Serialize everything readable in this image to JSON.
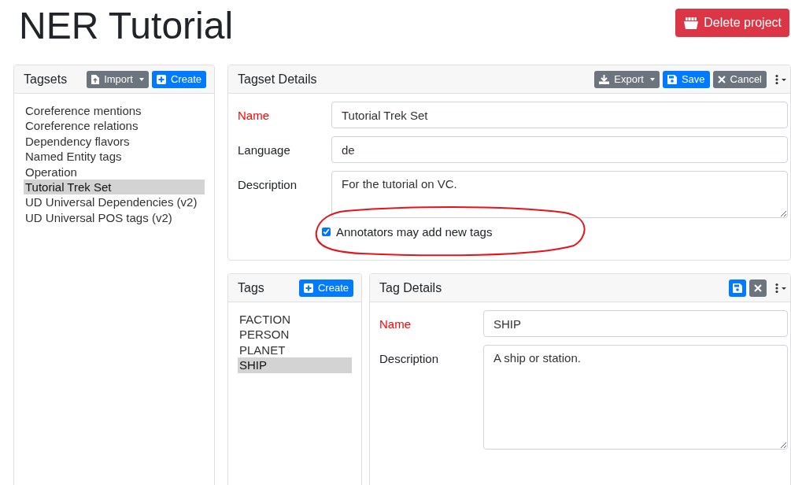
{
  "page_title": "NER Tutorial",
  "header_button": {
    "label": "Delete project",
    "kind": "danger"
  },
  "tagsets": {
    "title": "Tagsets",
    "buttons": [
      {
        "label": "Import",
        "kind": "secondary",
        "dropdown": true
      },
      {
        "label": "Create",
        "kind": "primary",
        "dropdown": false
      }
    ],
    "items": [
      {
        "label": "Coreference mentions",
        "selected": false
      },
      {
        "label": "Coreference relations",
        "selected": false
      },
      {
        "label": "Dependency flavors",
        "selected": false
      },
      {
        "label": "Named Entity tags",
        "selected": false
      },
      {
        "label": "Operation",
        "selected": false
      },
      {
        "label": "Tutorial Trek Set",
        "selected": true
      },
      {
        "label": "UD Universal Dependencies (v2)",
        "selected": false
      },
      {
        "label": "UD Universal POS tags (v2)",
        "selected": false
      }
    ]
  },
  "tagset_details": {
    "title": "Tagset Details",
    "buttons": [
      {
        "label": "Export",
        "kind": "secondary",
        "dropdown": true
      },
      {
        "label": "Save",
        "kind": "primary",
        "dropdown": false
      },
      {
        "label": "Cancel",
        "kind": "secondary",
        "dropdown": false
      }
    ],
    "fields": [
      {
        "label": "Name",
        "required": true,
        "kind": "input",
        "value": "Tutorial Trek Set"
      },
      {
        "label": "Language",
        "required": false,
        "kind": "input",
        "value": "de"
      },
      {
        "label": "Description",
        "required": false,
        "kind": "textarea",
        "value": "For the tutorial on VC."
      }
    ],
    "checkbox": {
      "label": "Annotators may add new tags",
      "checked": true
    }
  },
  "tags": {
    "title": "Tags",
    "buttons": [
      {
        "label": "Create",
        "kind": "primary",
        "dropdown": false
      }
    ],
    "items": [
      {
        "label": "FACTION",
        "selected": false
      },
      {
        "label": "PERSON",
        "selected": false
      },
      {
        "label": "PLANET",
        "selected": false
      },
      {
        "label": "SHIP",
        "selected": true
      }
    ]
  },
  "tag_details": {
    "title": "Tag Details",
    "buttons": [
      {
        "kind": "primary",
        "dropdown": false
      },
      {
        "kind": "secondary",
        "dropdown": false
      }
    ],
    "fields": [
      {
        "label": "Name",
        "required": true,
        "kind": "input",
        "value": "SHIP"
      },
      {
        "label": "Description",
        "required": false,
        "kind": "textarea",
        "value": "A ship or station."
      }
    ]
  },
  "annotation": {
    "kind": "ellipse"
  }
}
